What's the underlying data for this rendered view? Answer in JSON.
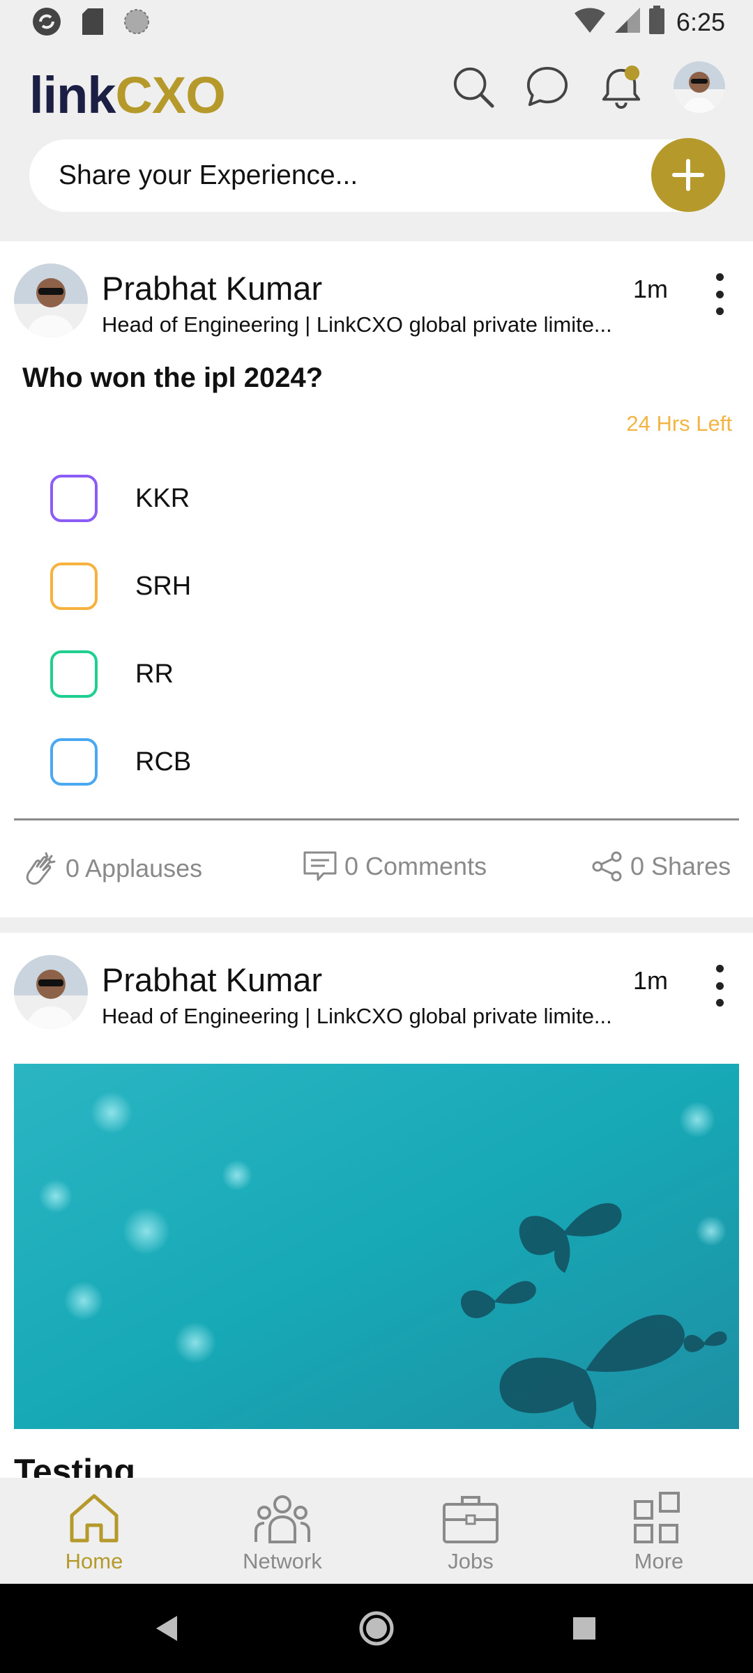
{
  "status_bar": {
    "time": "6:25",
    "icons": [
      "sync-icon",
      "sd-card-icon",
      "circle-icon",
      "wifi-icon",
      "signal-icon",
      "battery-icon"
    ]
  },
  "header": {
    "logo_text_left": "link",
    "logo_text_right": "CXO",
    "icons": [
      "search-icon",
      "chat-icon",
      "bell-icon",
      "avatar"
    ],
    "share_placeholder": "Share your Experience...",
    "colors": {
      "brand_gold": "#b59a2b",
      "brand_navy": "#1b1f43"
    }
  },
  "posts": [
    {
      "author": "Prabhat Kumar",
      "subtitle": "Head of Engineering | LinkCXO global private limite...",
      "time": "1m",
      "question": "Who won the ipl 2024?",
      "time_left": "24 Hrs Left",
      "options": [
        {
          "label": "KKR",
          "color": "#8b5cf6"
        },
        {
          "label": "SRH",
          "color": "#f6b23c"
        },
        {
          "label": "RR",
          "color": "#1fcf8f"
        },
        {
          "label": "RCB",
          "color": "#4aa8f0"
        }
      ],
      "applauses": "0 Applauses",
      "comments": "0 Comments",
      "shares": "0 Shares"
    },
    {
      "author": "Prabhat Kumar",
      "subtitle": "Head of Engineering | LinkCXO global private limite...",
      "time": "1m",
      "caption": "Testing"
    }
  ],
  "bottom_nav": [
    {
      "label": "Home",
      "icon": "home-icon",
      "active": true
    },
    {
      "label": "Network",
      "icon": "network-icon",
      "active": false
    },
    {
      "label": "Jobs",
      "icon": "briefcase-icon",
      "active": false
    },
    {
      "label": "More",
      "icon": "grid-icon",
      "active": false
    }
  ]
}
